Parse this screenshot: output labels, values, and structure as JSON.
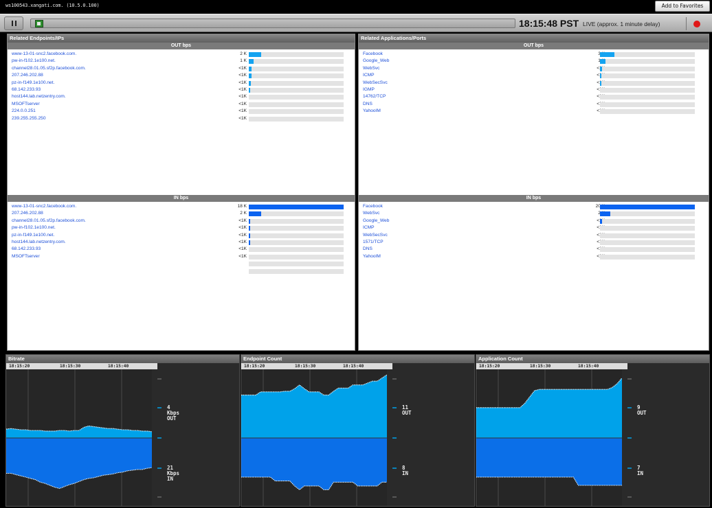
{
  "header": {
    "host": "ws100543.xangati.com. (10.5.0.100)",
    "favorites_label": "Add to Favorites"
  },
  "toolbar": {
    "time": "18:15:48 PST",
    "live_status": "LIVE (approx. 1 minute  delay)",
    "play_state": "paused"
  },
  "endpoints": {
    "title": "Related Endpoints/IPs",
    "out": {
      "header": "OUT bps",
      "rows": [
        {
          "name": "www-13-01-snc2.facebook.com.",
          "value": "2 K",
          "fraction": 0.13
        },
        {
          "name": "pw-in-f102.1e100.net.",
          "value": "1 K",
          "fraction": 0.05
        },
        {
          "name": "channel28.01.05.sf2p.facebook.com.",
          "value": "<1K",
          "fraction": 0.03
        },
        {
          "name": "207.246.202.88",
          "value": "<1K",
          "fraction": 0.03
        },
        {
          "name": "pz-in-f149.1e100.net.",
          "value": "<1K",
          "fraction": 0.02
        },
        {
          "name": "68.142.233.93",
          "value": "<1K",
          "fraction": 0.01
        },
        {
          "name": "host144.lab.netzentry.com.",
          "value": "<1K",
          "fraction": 0
        },
        {
          "name": "MSOFTserver",
          "value": "<1K",
          "fraction": 0
        },
        {
          "name": "224.0.0.251",
          "value": "<1K",
          "fraction": 0
        },
        {
          "name": "239.255.255.250",
          "value": "<1K",
          "fraction": 0
        }
      ]
    },
    "in": {
      "header": "IN bps",
      "rows": [
        {
          "name": "www-13-01-snc2.facebook.com.",
          "value": "18 K",
          "fraction": 1.0
        },
        {
          "name": "207.246.202.88",
          "value": "2 K",
          "fraction": 0.13
        },
        {
          "name": "channel28.01.05.sf2p.facebook.com.",
          "value": "<1K",
          "fraction": 0.015
        },
        {
          "name": "pw-in-f102.1e100.net.",
          "value": "<1K",
          "fraction": 0.015
        },
        {
          "name": "pz-in-f149.1e100.net.",
          "value": "<1K",
          "fraction": 0.01
        },
        {
          "name": "host144.lab.netzentry.com.",
          "value": "<1K",
          "fraction": 0.005
        },
        {
          "name": "68.142.233.93",
          "value": "<1K",
          "fraction": 0
        },
        {
          "name": "MSOFTserver",
          "value": "<1K",
          "fraction": 0
        },
        {
          "name": "",
          "value": "",
          "fraction": 0
        },
        {
          "name": "",
          "value": "",
          "fraction": 0
        }
      ]
    }
  },
  "applications": {
    "title": "Related Applications/Ports",
    "out": {
      "header": "OUT bps",
      "rows": [
        {
          "name": "Facebook",
          "value": "3 K",
          "fraction": 0.15
        },
        {
          "name": "Google_Web",
          "value": "1 K",
          "fraction": 0.06
        },
        {
          "name": "WebSvc",
          "value": "<1K",
          "fraction": 0.02
        },
        {
          "name": "ICMP",
          "value": "<1K",
          "fraction": 0.005
        },
        {
          "name": "WebSecSvc",
          "value": "<1K",
          "fraction": 0.005
        },
        {
          "name": "IGMP",
          "value": "<1K",
          "fraction": 0
        },
        {
          "name": "14762/TCP",
          "value": "<1K",
          "fraction": 0
        },
        {
          "name": "DNS",
          "value": "<1K",
          "fraction": 0
        },
        {
          "name": "YahooIM",
          "value": "<1K",
          "fraction": 0
        }
      ]
    },
    "in": {
      "header": "IN bps",
      "rows": [
        {
          "name": "Facebook",
          "value": "20 K",
          "fraction": 1.0
        },
        {
          "name": "WebSvc",
          "value": "2 K",
          "fraction": 0.11
        },
        {
          "name": "Google_Web",
          "value": "<1K",
          "fraction": 0.02
        },
        {
          "name": "ICMP",
          "value": "<1K",
          "fraction": 0
        },
        {
          "name": "WebSecSvc",
          "value": "<1K",
          "fraction": 0
        },
        {
          "name": "1571/TCP",
          "value": "<1K",
          "fraction": 0
        },
        {
          "name": "DNS",
          "value": "<1K",
          "fraction": 0
        },
        {
          "name": "YahooIM",
          "value": "<1K",
          "fraction": 0
        }
      ]
    }
  },
  "charts": [
    {
      "title": "Bitrate",
      "times": [
        "18:15:20",
        "18:15:30",
        "18:15:40"
      ],
      "out_label": [
        "4",
        "Kbps",
        "OUT"
      ],
      "in_label": [
        "21",
        "Kbps",
        "IN"
      ],
      "out_series": [
        0.14,
        0.15,
        0.14,
        0.13,
        0.13,
        0.12,
        0.12,
        0.12,
        0.11,
        0.11,
        0.11,
        0.12,
        0.12,
        0.11,
        0.12,
        0.12,
        0.17,
        0.19,
        0.18,
        0.17,
        0.16,
        0.15,
        0.15,
        0.14,
        0.13,
        0.13,
        0.12,
        0.12,
        0.11,
        0.11,
        0.1
      ],
      "in_series": [
        0.56,
        0.56,
        0.58,
        0.6,
        0.62,
        0.64,
        0.66,
        0.7,
        0.72,
        0.75,
        0.78,
        0.8,
        0.77,
        0.74,
        0.72,
        0.69,
        0.66,
        0.64,
        0.63,
        0.61,
        0.59,
        0.58,
        0.57,
        0.55,
        0.54,
        0.52,
        0.51,
        0.5,
        0.5,
        0.48,
        0.47
      ]
    },
    {
      "title": "Endpoint Count",
      "times": [
        "18:15:20",
        "18:15:30",
        "18:15:40"
      ],
      "out_label": [
        "11",
        "OUT"
      ],
      "in_label": [
        "8",
        "IN"
      ],
      "out_series": [
        0.68,
        0.68,
        0.68,
        0.68,
        0.73,
        0.73,
        0.73,
        0.73,
        0.73,
        0.74,
        0.74,
        0.78,
        0.84,
        0.78,
        0.73,
        0.73,
        0.73,
        0.68,
        0.68,
        0.74,
        0.79,
        0.79,
        0.79,
        0.84,
        0.84,
        0.84,
        0.87,
        0.9,
        0.9,
        0.95,
        1.0
      ],
      "in_series": [
        0.62,
        0.62,
        0.62,
        0.62,
        0.62,
        0.62,
        0.62,
        0.68,
        0.68,
        0.68,
        0.68,
        0.76,
        0.82,
        0.76,
        0.76,
        0.76,
        0.76,
        0.82,
        0.82,
        0.7,
        0.7,
        0.7,
        0.7,
        0.7,
        0.76,
        0.76,
        0.76,
        0.76,
        0.76,
        0.7,
        0.7
      ]
    },
    {
      "title": "Application Count",
      "times": [
        "18:15:20",
        "18:15:30",
        "18:15:40"
      ],
      "out_label": [
        "9",
        "OUT"
      ],
      "in_label": [
        "7",
        "IN"
      ],
      "out_series": [
        0.48,
        0.48,
        0.48,
        0.48,
        0.48,
        0.48,
        0.48,
        0.48,
        0.48,
        0.48,
        0.55,
        0.65,
        0.75,
        0.77,
        0.77,
        0.77,
        0.77,
        0.77,
        0.77,
        0.77,
        0.77,
        0.77,
        0.77,
        0.77,
        0.77,
        0.77,
        0.77,
        0.77,
        0.8,
        0.86,
        0.95
      ],
      "in_series": [
        0.62,
        0.62,
        0.62,
        0.62,
        0.62,
        0.62,
        0.62,
        0.62,
        0.62,
        0.62,
        0.62,
        0.62,
        0.62,
        0.62,
        0.62,
        0.62,
        0.62,
        0.62,
        0.62,
        0.62,
        0.62,
        0.75,
        0.75,
        0.75,
        0.75,
        0.75,
        0.75,
        0.75,
        0.75,
        0.75,
        0.75
      ]
    }
  ],
  "colors": {
    "out_bar": "#15a3f0",
    "in_bar": "#0b63f0",
    "out_area": "#00a2ea",
    "in_area": "#0b6fe8",
    "link": "#1c4fd8"
  }
}
